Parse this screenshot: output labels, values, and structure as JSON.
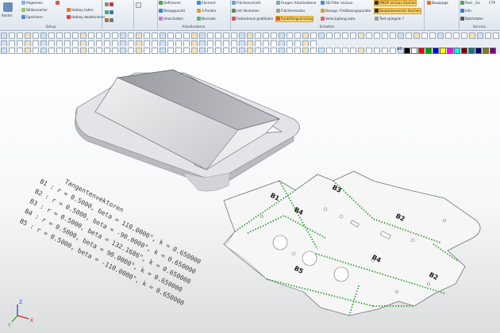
{
  "ribbon": {
    "groups": [
      {
        "label": "Setup"
      },
      {
        "label": ""
      },
      {
        "label": ""
      },
      {
        "label": "Arbeitsebene"
      },
      {
        "label": "Schalten"
      },
      {
        "label": ""
      },
      {
        "label": "Service"
      }
    ],
    "setup": {
      "raster": "Raster",
      "allgemein": "Allgemein",
      "speichern": "Speichern",
      "stilkonverter": "Stilkonverter",
      "hotkey_laden": "Hotkey laden",
      "hotkey_deaktivieren": "Hotkey deaktivieren"
    },
    "plane": {
      "definieren": "Definieren",
      "element": "Element",
      "bezugspunkt": "Bezugspunkt",
      "drei_punkte": "3 Punkte",
      "umschalten": "Umschalten",
      "normale": "Normale"
    },
    "switch": {
      "flaechen": "Flächenschnitt",
      "mit_verziehen": "mit Verziehen",
      "fadenkreuz": "Fadenkreuz groß/klein",
      "fangen": "Fangen Arbeitsebene",
      "flaechenmodus": "Flächenmodus",
      "punktfangvorschau": "Punktfangvorschau",
      "filter": "3D-Filter ein/aus",
      "bezugspunkte": "Bezugs.-Fleißbezugspunkte",
      "verknuepfung": "Verknüpfung auto.",
      "mkdp": "MKDP ein/aus löschen",
      "bauteilelemente": "Bauteilelemente löschen",
      "text_spiegeln": "Text spiegeln ?"
    },
    "misc": {
      "bauspage": "Bauspage"
    },
    "service": {
      "pack_go": "Pack _Go",
      "info": "Info",
      "batchdatei": "Batchdatei",
      "ctp": "CTP"
    }
  },
  "toolbar": {
    "all_label": "All"
  },
  "colors": {
    "palette": [
      "#000000",
      "#ffffff",
      "#ff0000",
      "#00a000",
      "#0000ff",
      "#ffff00",
      "#ff00ff",
      "#00ffff",
      "#800000",
      "#008080",
      "#000080",
      "#808000",
      "#800080",
      "#c0c0c0",
      "#808080",
      "#ff8040",
      "#804000",
      "#004080",
      "#8080ff",
      "#ff80c0"
    ],
    "bend_line": "#2e9e2e",
    "accent_highlight": "#fbd36b"
  },
  "annotation": {
    "title": "Tangentenvektoren",
    "lines": [
      "B1 : r = 0.5000, beta = 110.0000°, k = 0.650000",
      "B2 : r = 0.5000, beta = -90.0000°, k = 0.650000",
      "B3 : r = 0.5000, beta = 132.1686°, k = 0.650000",
      "B4 : r = 0.5000, beta = 90.0000°, k = 0.650000",
      "B5 : r = 0.5000, beta = -110.0000°, k = 0.650000"
    ]
  },
  "bend_labels": [
    "B1",
    "B2",
    "B3",
    "B4",
    "B4",
    "B5",
    "B3",
    "B2"
  ],
  "axis_triad": {
    "x": "X",
    "y": "Y",
    "z": "Z"
  }
}
